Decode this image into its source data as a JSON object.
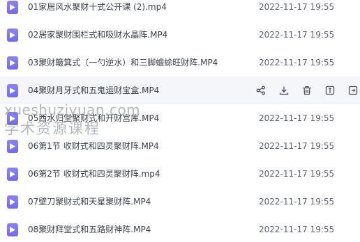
{
  "files": [
    {
      "name": "01家居风水聚财十式公开课 (2).mp4",
      "time": "2022-11-17 19:55",
      "icon": "video-file-icon"
    },
    {
      "name": "02居家聚财围栏式和吸财水晶阵.MP4",
      "time": "2022-11-17 19:55",
      "icon": "video-file-icon"
    },
    {
      "name": "03聚财簸箕式（一勺逆水）和三脚蟾蜍旺财阵.MP4",
      "time": "2022-11-17 19:55",
      "icon": "video-file-icon"
    },
    {
      "name": "04聚财月牙式和五鬼运财宝盒.MP4",
      "time": "",
      "icon": "video-file-icon"
    },
    {
      "name": "05西水归堂聚财式和开财宫库.MP4",
      "time": "2022-11-17 19:55",
      "icon": "video-file-icon"
    },
    {
      "name": "06第1节 收财式和四灵聚财阵.MP4",
      "time": "2022-11-17 19:55",
      "icon": "video-file-icon"
    },
    {
      "name": "06第2节 收财式和四灵聚财阵.mp4",
      "time": "2022-11-17 19:55",
      "icon": "video-file-icon"
    },
    {
      "name": "07壁刀聚财式和天星聚财阵.MP4",
      "time": "2022-11-17 19:55",
      "icon": "video-file-icon"
    },
    {
      "name": "08聚财拜堂式和五路财神阵.MP4",
      "time": "2022-11-17 19:55",
      "icon": "video-file-icon"
    }
  ],
  "hovered_row_actions": [
    {
      "icon": "share-icon"
    },
    {
      "icon": "download-icon"
    },
    {
      "icon": "delete-icon"
    },
    {
      "icon": "rename-icon"
    },
    {
      "icon": "move-icon"
    }
  ],
  "watermark": {
    "url": "xueshuziyuan.com",
    "text": "学术资源课程"
  },
  "colors": {
    "file_icon": "#7a73f3",
    "hover_bg": "#f5f6fa",
    "text": "#3b3f4a"
  }
}
